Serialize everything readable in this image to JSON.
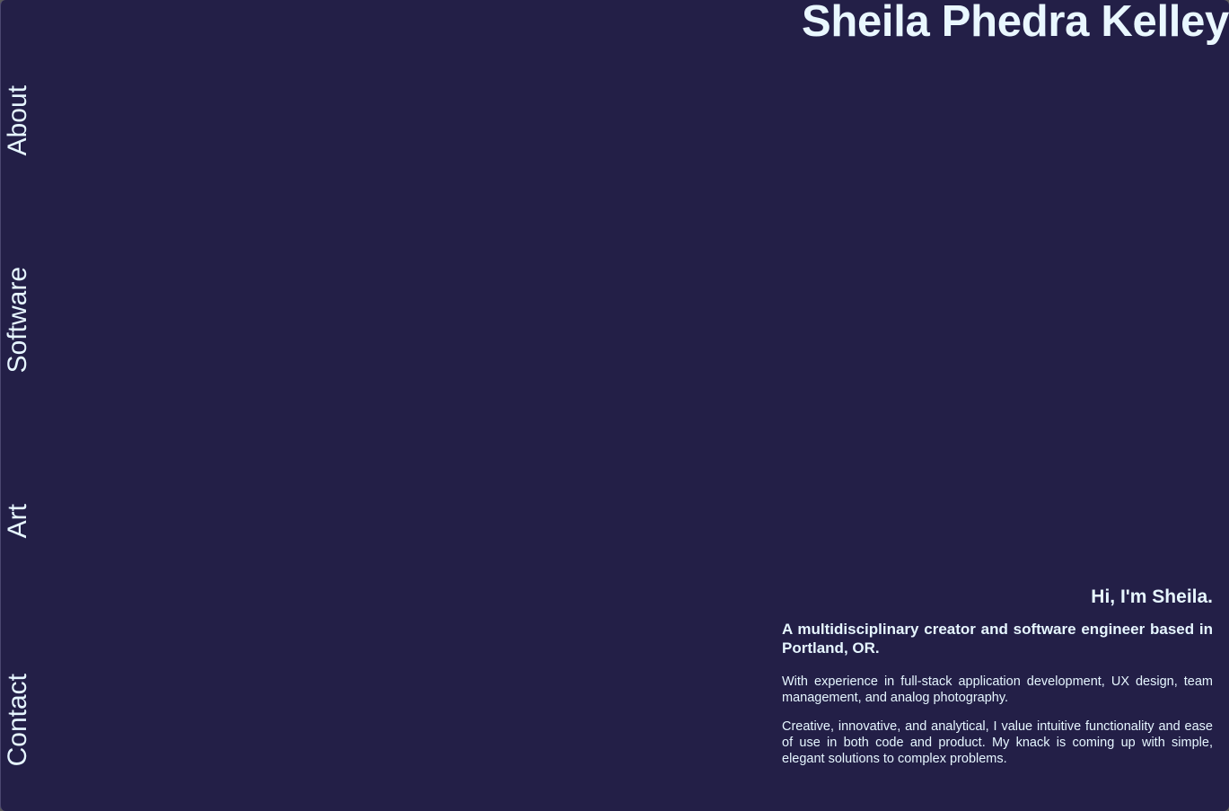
{
  "site": {
    "title": "Sheila Phedra Kelley"
  },
  "nav": {
    "items": [
      {
        "label": "About"
      },
      {
        "label": "Software"
      },
      {
        "label": "Art"
      },
      {
        "label": "Contact"
      }
    ]
  },
  "about": {
    "greeting": "Hi, I'm Sheila.",
    "tagline": "A multidisciplinary creator and software engineer based in Portland, OR.",
    "paragraphs": [
      "With experience in full-stack application development, UX design, team management, and analog photography.",
      "Creative, innovative, and analytical, I value intuitive functionality and ease of use in both code and product. My knack is coming up with simple, elegant solutions to complex problems."
    ]
  },
  "colors": {
    "background": "#231f47",
    "text": "#e6f6ff"
  }
}
